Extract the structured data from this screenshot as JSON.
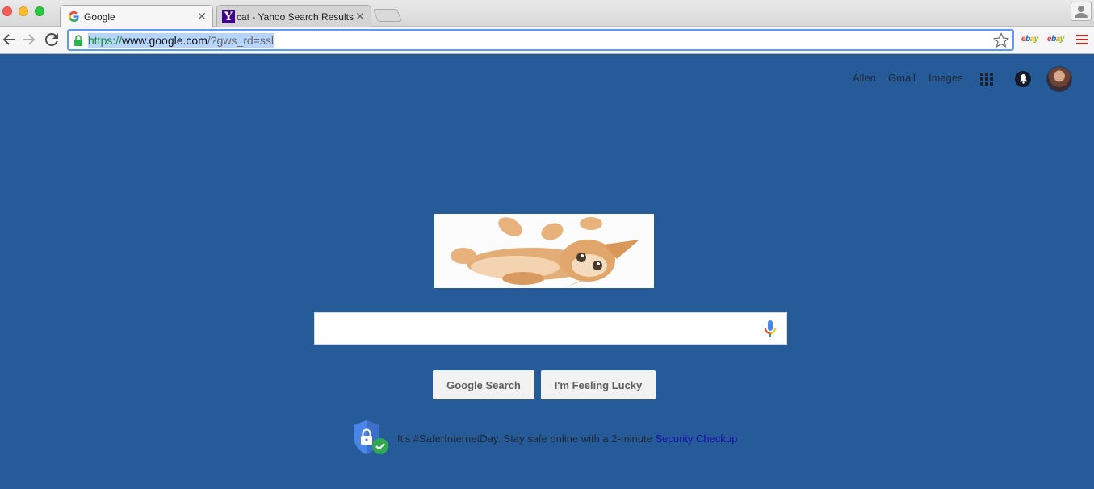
{
  "browser": {
    "tabs": [
      {
        "title": "Google",
        "favicon": "google-g-icon",
        "active": true
      },
      {
        "title": "cat - Yahoo Search Results",
        "favicon": "yahoo-y-icon",
        "active": false
      }
    ],
    "omnibox": {
      "url_scheme": "https://",
      "url_host": "www.google.com",
      "url_path": "/?gws_rd=ssl"
    },
    "extensions": [
      {
        "name": "ebay-icon",
        "letters": [
          "e",
          "b",
          "a",
          "y"
        ]
      },
      {
        "name": "ebay-icon",
        "letters": [
          "e",
          "b",
          "a",
          "y"
        ]
      }
    ]
  },
  "google": {
    "topnav": {
      "user": "Allen",
      "gmail": "Gmail",
      "images": "Images"
    },
    "search": {
      "value": "",
      "google_search_label": "Google Search",
      "lucky_label": "I'm Feeling Lucky"
    },
    "promo": {
      "text": "It's #SaferInternetDay. Stay safe online with a 2-minute ",
      "link": "Security Checkup"
    }
  },
  "colors": {
    "page_background": "#265b9a",
    "link": "#1a0dab",
    "omnibox_focus": "#5b9bf0"
  }
}
